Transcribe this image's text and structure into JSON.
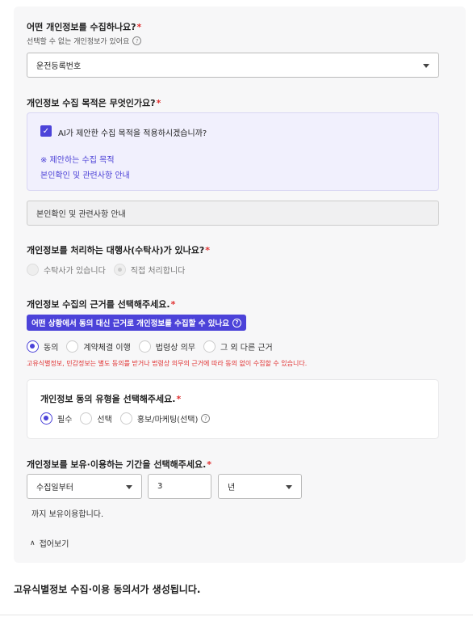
{
  "q1": {
    "title": "어떤 개인정보를 수집하나요?",
    "required": "*",
    "subtitle": "선택할 수 없는 개인정보가 있어요",
    "select_value": "운전등록번호"
  },
  "q2": {
    "title": "개인정보 수집 목적은 무엇인가요?",
    "required": "*",
    "ai_checkbox_label": "AI가 제안한 수집 목적을 적용하시겠습니까?",
    "ai_suggest_heading": "※ 제안하는 수집 목적",
    "ai_suggest_value": "본인확인 및 관련사항 안내",
    "field_value": "본인확인 및 관련사항 안내"
  },
  "q3": {
    "title": "개인정보를 처리하는 대행사(수탁사)가 있나요?",
    "required": "*",
    "options": [
      "수탁사가 있습니다",
      "직접 처리합니다"
    ]
  },
  "q4": {
    "title": "개인정보 수집의 근거를 선택해주세요.",
    "required": "*",
    "hint_button": "어떤 상황에서 동의 대신 근거로 개인정보를 수집할 수 있나요",
    "options": [
      "동의",
      "계약체결 이행",
      "법령상 의무",
      "그 외 다른 근거"
    ],
    "warning": "고유식별정보, 민감정보는 별도 동의를 받거나 법령상 의무의 근거에 따라 동의 없이 수집할 수 있습니다."
  },
  "q5": {
    "title": "개인정보 동의 유형을 선택해주세요.",
    "required": "*",
    "options": [
      "필수",
      "선택",
      "홍보/마케팅(선택)"
    ]
  },
  "q6": {
    "title": "개인정보를 보유·이용하는 기간을 선택해주세요.",
    "required": "*",
    "start_select": "수집일부터",
    "amount": "3",
    "unit_select": "년",
    "suffix": "까지 보유이용합니다."
  },
  "collapse_label": "접어보기",
  "footer_title": "고유식별정보 수집·이용 동의서가 생성됩니다.",
  "colors": {
    "accent": "#4c43d9",
    "warning": "#e03131",
    "panel": "#f7f7f8"
  }
}
